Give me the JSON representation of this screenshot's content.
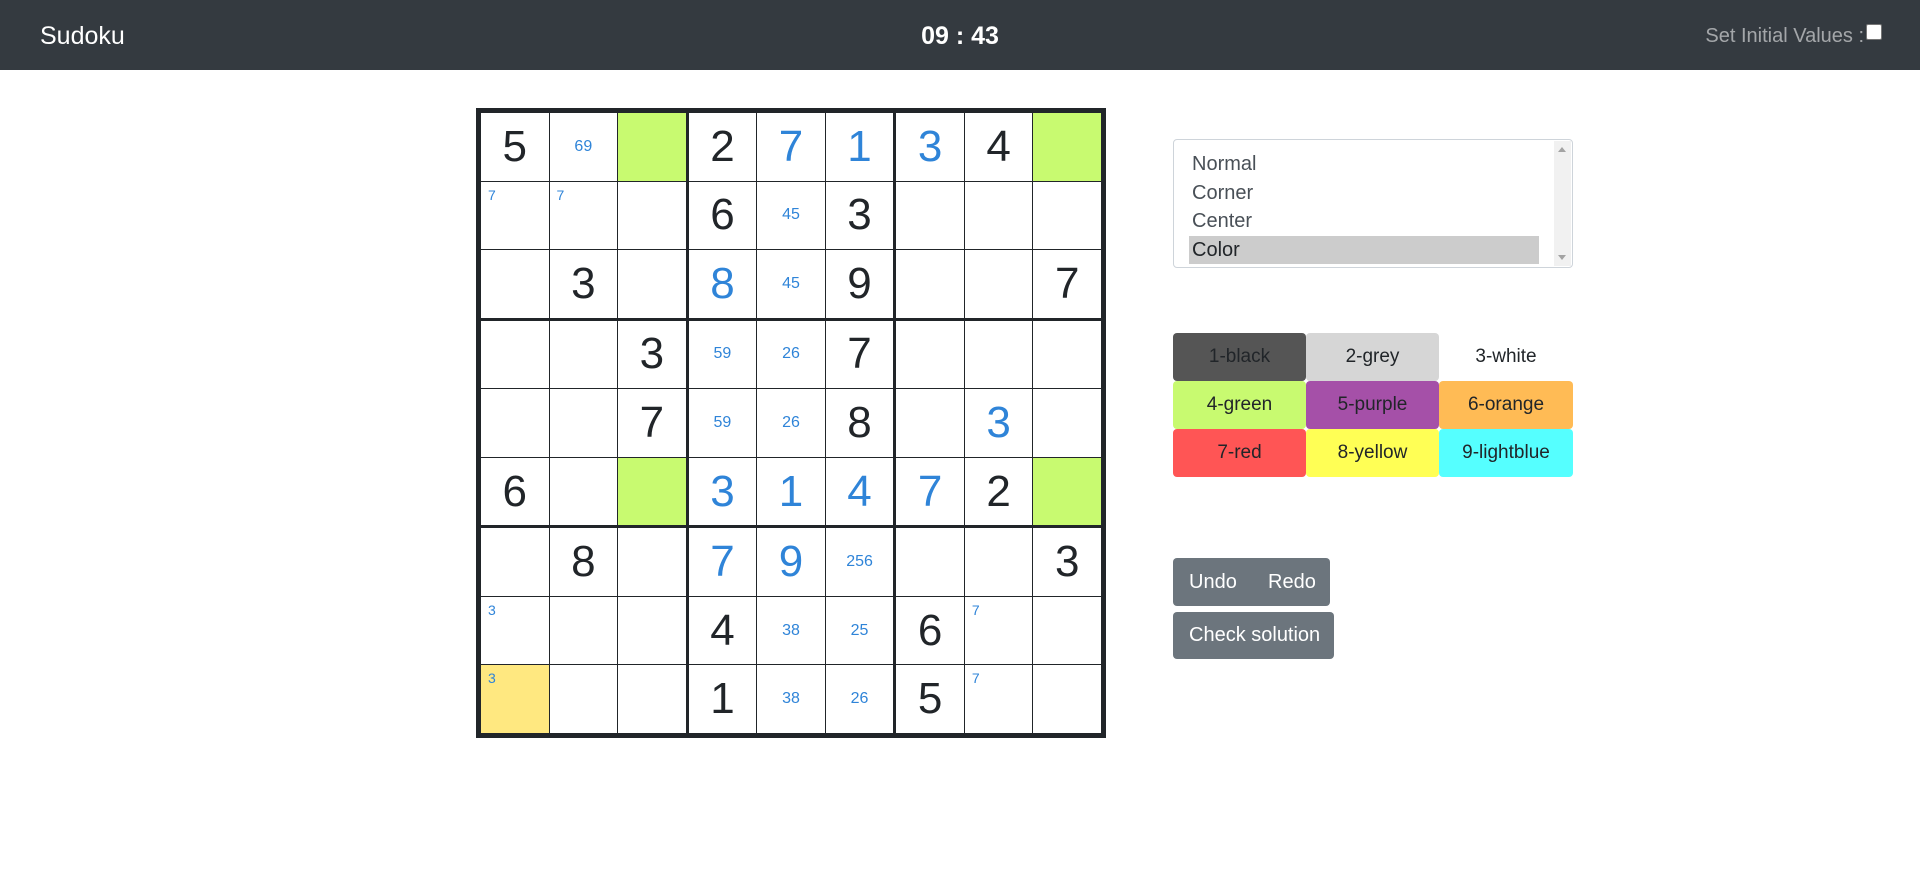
{
  "header": {
    "title": "Sudoku",
    "timer": "09 : 43",
    "set_initial_label": "Set Initial Values :"
  },
  "grid": [
    [
      {
        "v": "5",
        "t": "given"
      },
      {
        "v": "69",
        "t": "center"
      },
      {
        "v": "",
        "t": "empty",
        "color": "#c8fa70"
      },
      {
        "v": "2",
        "t": "given"
      },
      {
        "v": "7",
        "t": "user"
      },
      {
        "v": "1",
        "t": "user"
      },
      {
        "v": "3",
        "t": "user"
      },
      {
        "v": "4",
        "t": "given"
      },
      {
        "v": "",
        "t": "empty",
        "color": "#c8fa70"
      }
    ],
    [
      {
        "v": "7",
        "t": "corner"
      },
      {
        "v": "7",
        "t": "corner"
      },
      {
        "v": "",
        "t": "empty"
      },
      {
        "v": "6",
        "t": "given"
      },
      {
        "v": "45",
        "t": "center"
      },
      {
        "v": "3",
        "t": "given"
      },
      {
        "v": "",
        "t": "empty"
      },
      {
        "v": "",
        "t": "empty"
      },
      {
        "v": "",
        "t": "empty"
      }
    ],
    [
      {
        "v": "",
        "t": "empty"
      },
      {
        "v": "3",
        "t": "given"
      },
      {
        "v": "",
        "t": "empty"
      },
      {
        "v": "8",
        "t": "user"
      },
      {
        "v": "45",
        "t": "center"
      },
      {
        "v": "9",
        "t": "given"
      },
      {
        "v": "",
        "t": "empty"
      },
      {
        "v": "",
        "t": "empty"
      },
      {
        "v": "7",
        "t": "given"
      }
    ],
    [
      {
        "v": "",
        "t": "empty"
      },
      {
        "v": "",
        "t": "empty"
      },
      {
        "v": "3",
        "t": "given"
      },
      {
        "v": "59",
        "t": "center"
      },
      {
        "v": "26",
        "t": "center"
      },
      {
        "v": "7",
        "t": "given"
      },
      {
        "v": "",
        "t": "empty"
      },
      {
        "v": "",
        "t": "empty"
      },
      {
        "v": "",
        "t": "empty"
      }
    ],
    [
      {
        "v": "",
        "t": "empty"
      },
      {
        "v": "",
        "t": "empty"
      },
      {
        "v": "7",
        "t": "given"
      },
      {
        "v": "59",
        "t": "center"
      },
      {
        "v": "26",
        "t": "center"
      },
      {
        "v": "8",
        "t": "given"
      },
      {
        "v": "",
        "t": "empty"
      },
      {
        "v": "3",
        "t": "user"
      },
      {
        "v": "",
        "t": "empty"
      }
    ],
    [
      {
        "v": "6",
        "t": "given"
      },
      {
        "v": "",
        "t": "empty"
      },
      {
        "v": "",
        "t": "empty",
        "color": "#c8fa70"
      },
      {
        "v": "3",
        "t": "user"
      },
      {
        "v": "1",
        "t": "user"
      },
      {
        "v": "4",
        "t": "user"
      },
      {
        "v": "7",
        "t": "user"
      },
      {
        "v": "2",
        "t": "given"
      },
      {
        "v": "",
        "t": "empty",
        "color": "#c8fa70"
      }
    ],
    [
      {
        "v": "",
        "t": "empty"
      },
      {
        "v": "8",
        "t": "given"
      },
      {
        "v": "",
        "t": "empty"
      },
      {
        "v": "7",
        "t": "user"
      },
      {
        "v": "9",
        "t": "user"
      },
      {
        "v": "256",
        "t": "center"
      },
      {
        "v": "",
        "t": "empty"
      },
      {
        "v": "",
        "t": "empty"
      },
      {
        "v": "3",
        "t": "given"
      }
    ],
    [
      {
        "v": "3",
        "t": "corner"
      },
      {
        "v": "",
        "t": "empty"
      },
      {
        "v": "",
        "t": "empty"
      },
      {
        "v": "4",
        "t": "given"
      },
      {
        "v": "38",
        "t": "center"
      },
      {
        "v": "25",
        "t": "center"
      },
      {
        "v": "6",
        "t": "given"
      },
      {
        "v": "7",
        "t": "corner"
      },
      {
        "v": "",
        "t": "empty"
      }
    ],
    [
      {
        "v": "3",
        "t": "corner",
        "color": "#ffe880"
      },
      {
        "v": "",
        "t": "empty"
      },
      {
        "v": "",
        "t": "empty"
      },
      {
        "v": "1",
        "t": "given"
      },
      {
        "v": "38",
        "t": "center"
      },
      {
        "v": "26",
        "t": "center"
      },
      {
        "v": "5",
        "t": "given"
      },
      {
        "v": "7",
        "t": "corner"
      },
      {
        "v": "",
        "t": "empty"
      }
    ]
  ],
  "modes": {
    "options": [
      "Normal",
      "Corner",
      "Center",
      "Color"
    ],
    "selected": "Color"
  },
  "colors": [
    {
      "label": "1-black",
      "bg": "#555555"
    },
    {
      "label": "2-grey",
      "bg": "#d6d6d6"
    },
    {
      "label": "3-white",
      "bg": "#ffffff"
    },
    {
      "label": "4-green",
      "bg": "#c8fa70"
    },
    {
      "label": "5-purple",
      "bg": "#a550a8"
    },
    {
      "label": "6-orange",
      "bg": "#ffbb55"
    },
    {
      "label": "7-red",
      "bg": "#ff5555"
    },
    {
      "label": "8-yellow",
      "bg": "#ffff55"
    },
    {
      "label": "9-lightblue",
      "bg": "#55ffff"
    }
  ],
  "actions": {
    "undo": "Undo",
    "redo": "Redo",
    "check": "Check solution"
  }
}
